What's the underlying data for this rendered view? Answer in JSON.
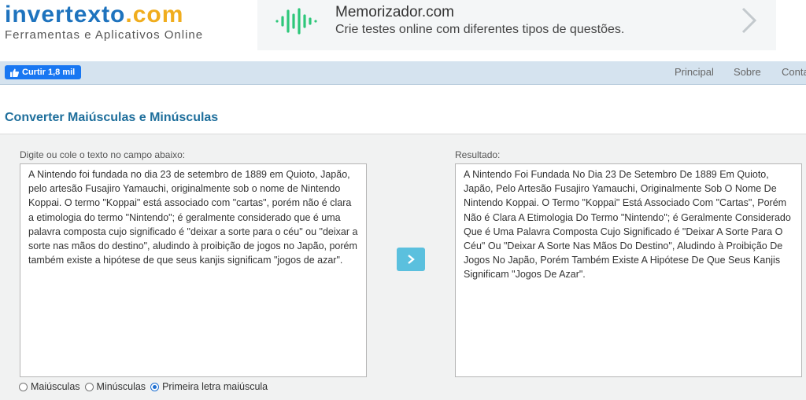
{
  "logo": {
    "name_main": "invertexto",
    "name_dot": ".",
    "name_tld": "com",
    "tagline": "Ferramentas e Aplicativos Online"
  },
  "ad": {
    "title": "Memorizador.com",
    "description": "Crie testes online com diferentes tipos de questões.",
    "icon": "waveform-icon",
    "arrow_icon": "chevron-right-icon"
  },
  "social": {
    "like_label": "Curtir 1,8 mil"
  },
  "nav": {
    "items": [
      "Principal",
      "Sobre",
      "Conta"
    ]
  },
  "page": {
    "title": "Converter Maiúsculas e Minúsculas"
  },
  "input": {
    "label": "Digite ou cole o texto no campo abaixo:",
    "value": "A Nintendo foi fundada no dia 23 de setembro de 1889 em Quioto, Japão, pelo artesão Fusajiro Yamauchi, originalmente sob o nome de Nintendo Koppai. O termo \"Koppai\" está associado com \"cartas\", porém não é clara a etimologia do termo \"Nintendo\"; é geralmente considerado que é uma palavra composta cujo significado é \"deixar a sorte para o céu\" ou \"deixar a sorte nas mãos do destino\", aludindo à proibição de jogos no Japão, porém também existe a hipótese de que seus kanjis significam \"jogos de azar\"."
  },
  "output": {
    "label": "Resultado:",
    "value": "A Nintendo Foi Fundada No Dia 23 De Setembro De 1889 Em Quioto, Japão, Pelo Artesão Fusajiro Yamauchi, Originalmente Sob O Nome De Nintendo Koppai. O Termo \"Koppai\" Está Associado Com \"Cartas\", Porém Não é Clara A Etimologia Do Termo \"Nintendo\"; é Geralmente Considerado Que é Uma Palavra Composta Cujo Significado é \"Deixar A Sorte Para O Céu\" Ou \"Deixar A Sorte Nas Mãos Do Destino\", Aludindo à Proibição De Jogos No Japão, Porém Também Existe A Hipótese De Que Seus Kanjis Significam \"Jogos De Azar\"."
  },
  "options": [
    {
      "label": "Maiúsculas",
      "checked": false
    },
    {
      "label": "Minúsculas",
      "checked": false
    },
    {
      "label": "Primeira letra maiúscula",
      "checked": true
    }
  ],
  "colors": {
    "brand_blue": "#1e73be",
    "brand_orange": "#f0ad1e",
    "accent_green": "#2ec77a",
    "button_blue": "#5bc0de",
    "facebook_blue": "#1877f2"
  }
}
